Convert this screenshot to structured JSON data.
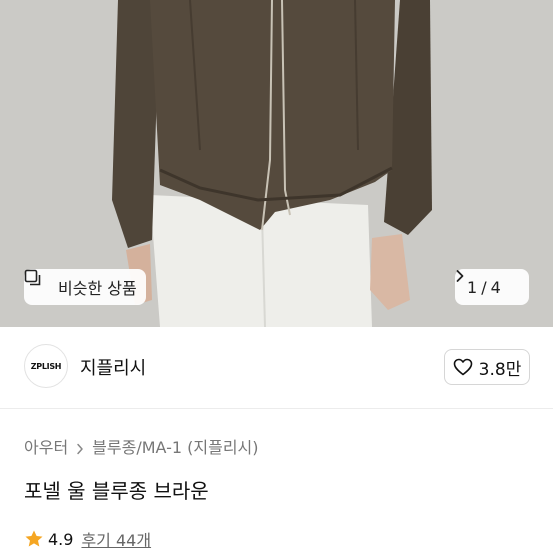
{
  "hero": {
    "similar_products_label": "비슷한 상품",
    "pager_current": "1",
    "pager_total": "4",
    "pager_separator": "/"
  },
  "brand": {
    "logo_text": "ZPLISH",
    "name": "지플리시",
    "likes": "3.8만"
  },
  "breadcrumb": {
    "items": [
      "아우터",
      "블루종/MA-1 (지플리시)"
    ]
  },
  "product": {
    "title": "포넬 울 블루종 브라운",
    "rating": "4.9",
    "reviews_label": "후기 44개"
  },
  "colors": {
    "jacket": "#4f4539",
    "pants": "#eeeeea",
    "star": "#f5a623"
  }
}
